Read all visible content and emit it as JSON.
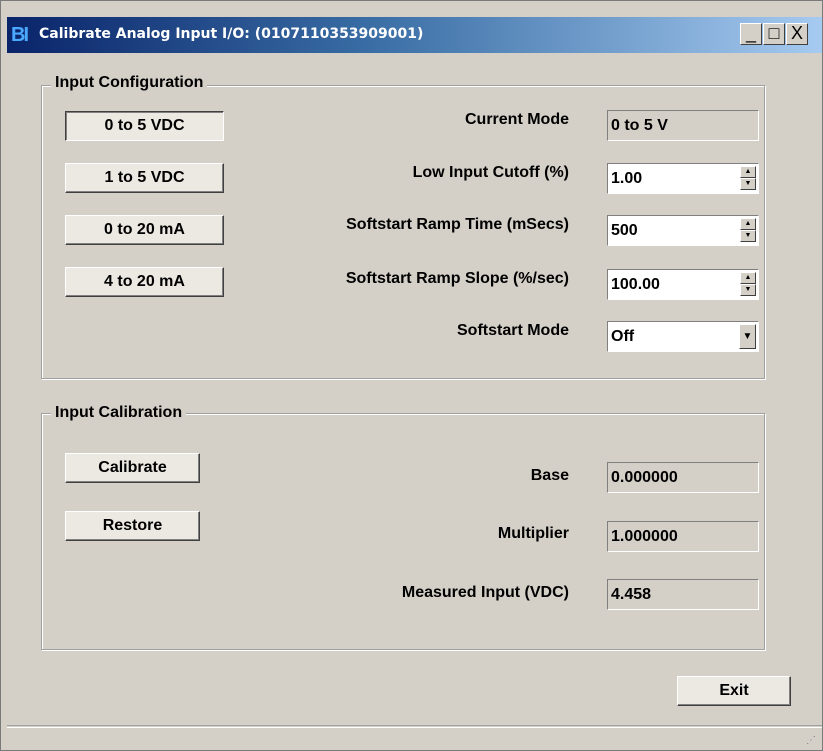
{
  "window": {
    "title": "Calibrate Analog Input I/O: (0107110353909001)",
    "icon_text": "BI",
    "controls": {
      "minimize": "_",
      "maximize": "□",
      "close": "X"
    }
  },
  "input_configuration": {
    "legend": "Input Configuration",
    "mode_buttons": [
      "0 to 5 VDC",
      "1 to 5 VDC",
      "0 to 20 mA",
      "4 to 20 mA"
    ],
    "current_mode": {
      "label": "Current Mode",
      "value": "0 to 5 V"
    },
    "low_input_cutoff": {
      "label": "Low Input Cutoff (%)",
      "value": "1.00"
    },
    "softstart_ramp_time": {
      "label": "Softstart Ramp Time (mSecs)",
      "value": "500"
    },
    "softstart_ramp_slope": {
      "label": "Softstart Ramp Slope (%/sec)",
      "value": "100.00"
    },
    "softstart_mode": {
      "label": "Softstart Mode",
      "value": "Off"
    }
  },
  "input_calibration": {
    "legend": "Input Calibration",
    "calibrate_label": "Calibrate",
    "restore_label": "Restore",
    "base": {
      "label": "Base",
      "value": "0.000000"
    },
    "multiplier": {
      "label": "Multiplier",
      "value": "1.000000"
    },
    "measured_input": {
      "label": "Measured Input (VDC)",
      "value": "4.458"
    }
  },
  "footer": {
    "exit_label": "Exit"
  }
}
